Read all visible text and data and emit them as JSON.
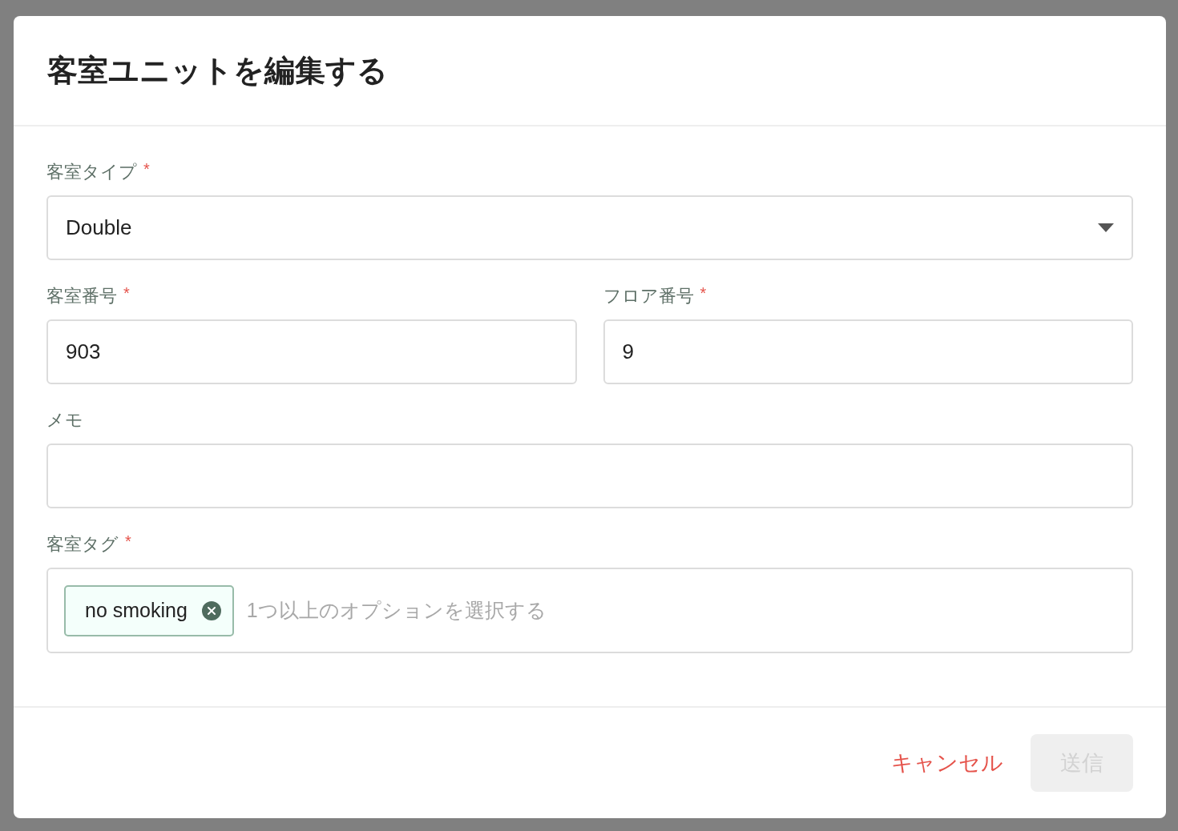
{
  "dialog": {
    "title": "客室ユニットを編集する"
  },
  "fields": [
    {
      "kind": "select",
      "label": "客室タイプ",
      "required": true,
      "value": "Double"
    },
    {
      "kind": "pair",
      "items": [
        {
          "label": "客室番号",
          "required": true,
          "value": "903"
        },
        {
          "label": "フロア番号",
          "required": true,
          "value": "9"
        }
      ]
    },
    {
      "kind": "text",
      "label": "メモ",
      "required": false
    },
    {
      "kind": "tags",
      "label": "客室タグ",
      "required": true,
      "tags": [
        "no smoking"
      ],
      "placeholder": "1つ以上のオプションを選択する"
    }
  ],
  "required_mark": "*",
  "footer": {
    "cancel": "キャンセル",
    "submit": {
      "label": "送信",
      "disabled": true
    }
  }
}
